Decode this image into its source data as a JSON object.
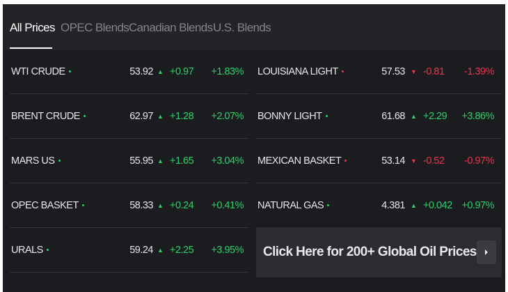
{
  "tabs": [
    {
      "label": "All Prices",
      "active": true
    },
    {
      "label": "OPEC Blends",
      "active": false
    },
    {
      "label": "Canadian Blends",
      "active": false
    },
    {
      "label": "U.S. Blends",
      "active": false
    }
  ],
  "colors": {
    "up": "#2bd16b",
    "down": "#e8354a",
    "background": "#1b1c1f"
  },
  "icons": {
    "up": "triangle-up-icon",
    "down": "triangle-down-icon",
    "cta": "chevron-right-icon"
  },
  "prices_left": [
    {
      "name": "WTI CRUDE",
      "price": "53.92",
      "change": "+0.97",
      "percent": "+1.83%",
      "direction": "up"
    },
    {
      "name": "BRENT CRUDE",
      "price": "62.97",
      "change": "+1.28",
      "percent": "+2.07%",
      "direction": "up"
    },
    {
      "name": "MARS US",
      "price": "55.95",
      "change": "+1.65",
      "percent": "+3.04%",
      "direction": "up"
    },
    {
      "name": "OPEC BASKET",
      "price": "58.33",
      "change": "+0.24",
      "percent": "+0.41%",
      "direction": "up"
    },
    {
      "name": "URALS",
      "price": "59.24",
      "change": "+2.25",
      "percent": "+3.95%",
      "direction": "up"
    }
  ],
  "prices_right": [
    {
      "name": "LOUISIANA LIGHT",
      "price": "57.53",
      "change": "-0.81",
      "percent": "-1.39%",
      "direction": "down"
    },
    {
      "name": "BONNY LIGHT",
      "price": "61.68",
      "change": "+2.29",
      "percent": "+3.86%",
      "direction": "up"
    },
    {
      "name": "MEXICAN BASKET",
      "price": "53.14",
      "change": "-0.52",
      "percent": "-0.97%",
      "direction": "down"
    },
    {
      "name": "NATURAL GAS",
      "price": "4.381",
      "change": "+0.042",
      "percent": "+0.97%",
      "direction": "up"
    }
  ],
  "cta": {
    "label": "Click Here for 200+ Global Oil Prices"
  }
}
